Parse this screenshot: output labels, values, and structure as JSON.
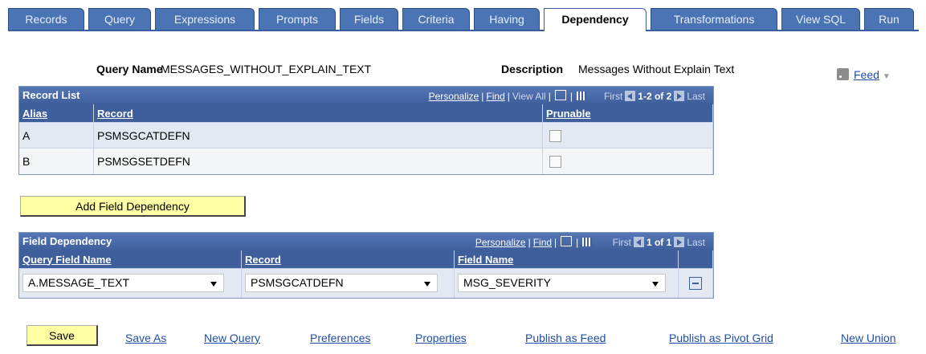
{
  "tabs": [
    "Records",
    "Query",
    "Expressions",
    "Prompts",
    "Fields",
    "Criteria",
    "Having",
    "Dependency",
    "Transformations",
    "View SQL",
    "Run"
  ],
  "active_tab": "Dependency",
  "header": {
    "query_name_label": "Query Name",
    "query_name_value": "MESSAGES_WITHOUT_EXPLAIN_TEXT",
    "description_label": "Description",
    "description_value": "Messages Without Explain Text",
    "feed_label": "Feed"
  },
  "record_list": {
    "title": "Record List",
    "personalize": "Personalize",
    "find": "Find",
    "view_all": "View All",
    "first": "First",
    "range": "1-2 of 2",
    "last": "Last",
    "columns": [
      "Alias",
      "Record",
      "Prunable"
    ],
    "rows": [
      {
        "alias": "A",
        "record": "PSMSGCATDEFN"
      },
      {
        "alias": "B",
        "record": "PSMSGSETDEFN"
      }
    ]
  },
  "add_field_dependency_label": "Add Field Dependency",
  "field_dependency": {
    "title": "Field Dependency",
    "personalize": "Personalize",
    "find": "Find",
    "first": "First",
    "range": "1 of 1",
    "last": "Last",
    "columns": [
      "Query Field Name",
      "Record",
      "Field Name"
    ],
    "row": {
      "query_field": "A.MESSAGE_TEXT",
      "record": "PSMSGCATDEFN",
      "field_name": "MSG_SEVERITY"
    }
  },
  "footer": {
    "save": "Save",
    "save_as": "Save As",
    "new_query": "New Query",
    "preferences": "Preferences",
    "properties": "Properties",
    "publish_feed": "Publish as Feed",
    "publish_pivot": "Publish as Pivot Grid",
    "new_union": "New Union"
  }
}
